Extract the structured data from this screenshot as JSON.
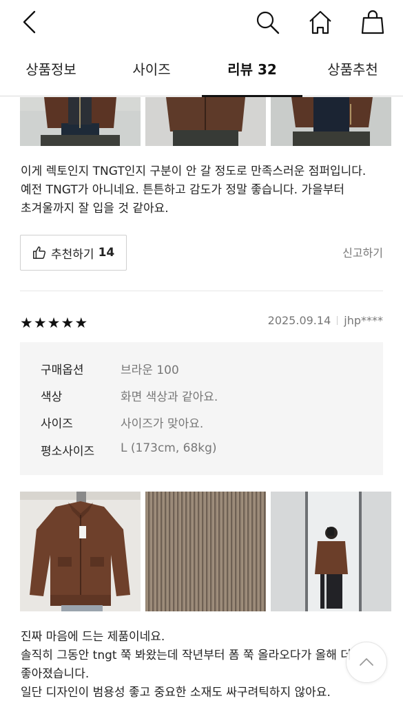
{
  "nav": {
    "back_icon": "chevron-left-icon",
    "search_icon": "search-icon",
    "home_icon": "home-icon",
    "cart_icon": "shopping-bag-icon"
  },
  "tabs": [
    {
      "label": "상품정보",
      "active": false
    },
    {
      "label": "사이즈",
      "active": false
    },
    {
      "label": "리뷰 32",
      "active": true
    },
    {
      "label": "상품추천",
      "active": false
    }
  ],
  "review1": {
    "text": "이게 렉토인지 TNGT인지 구분이 안 갈 정도로 만족스러운 점퍼입니다. 예전 TNGT가 아니네요. 튼튼하고 감도가 정말 좋습니다. 가을부터 초겨울까지 잘 입을 것 같아요.",
    "like_label": "추천하기",
    "like_count": "14",
    "report_label": "신고하기"
  },
  "review2": {
    "rating": 5,
    "date": "2025.09.14",
    "user": "jhp****",
    "options": [
      {
        "label": "구매옵션",
        "value": "브라운 100"
      },
      {
        "label": "색상",
        "value": "화면 색상과 같아요."
      },
      {
        "label": "사이즈",
        "value": "사이즈가 맞아요."
      },
      {
        "label": "평소사이즈",
        "value": "L (173cm, 68kg)"
      }
    ],
    "text_lines": [
      "진짜 마음에 드는 제품이네요.",
      "솔직히 그동안 tngt 쭉 봐왔는데 작년부터 폼 쭉 올라오다가 올해 더 좋아졌습니다.",
      "일단 디자인이 범용성 좋고 중요한 소재도 싸구려틱하지 않아요."
    ]
  },
  "colors": {
    "text": "#111111",
    "muted": "#777777",
    "border": "#d9d9d9",
    "option_bg": "#f5f5f5",
    "jacket_brown": "#6b3f2a"
  },
  "icons": {
    "thumb": "thumbs-up-icon",
    "star": "star-icon",
    "scroll_top": "chevron-up-icon"
  }
}
